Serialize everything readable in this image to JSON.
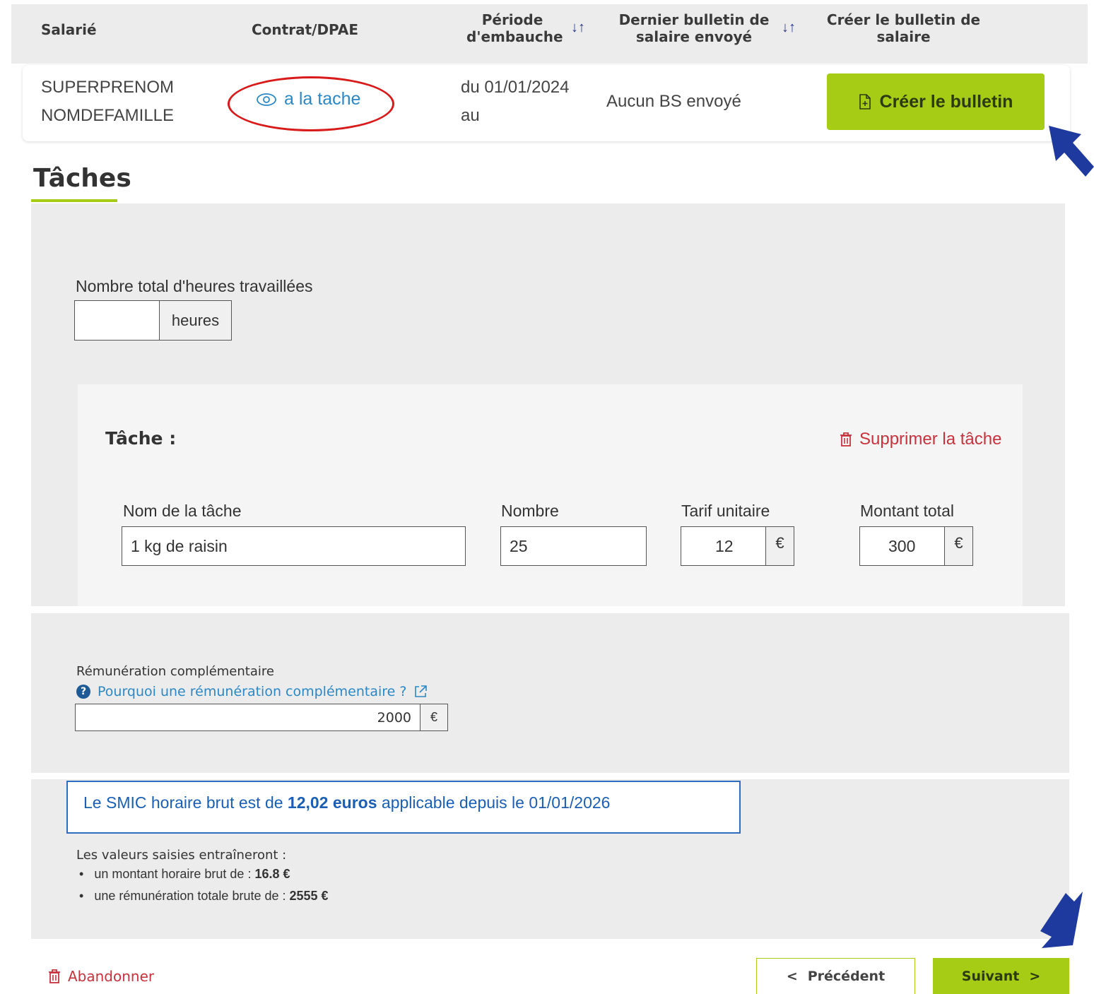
{
  "table": {
    "headers": {
      "salarie": "Salarié",
      "contrat": "Contrat/DPAE",
      "periode_line1": "Période",
      "periode_line2": "d'embauche",
      "dernier_line1": "Dernier bulletin de",
      "dernier_line2": "salaire envoyé",
      "creer_line1": "Créer le bulletin de",
      "creer_line2": "salaire",
      "sort_icon": "↓↑"
    },
    "row": {
      "prenom": "SUPERPRENOM",
      "nom": "NOMDEFAMILLE",
      "contract_link": "a la tache",
      "periode_line1": "du 01/01/2024",
      "periode_line2": "au",
      "dernier": "Aucun BS envoyé",
      "create_button": "Créer le bulletin"
    }
  },
  "section": {
    "title": "Tâches"
  },
  "hours": {
    "label": "Nombre total d'heures travaillées",
    "value": "",
    "unit": "heures"
  },
  "task": {
    "title": "Tâche :",
    "delete_label": "Supprimer la tâche",
    "fields": {
      "name_label": "Nom de la tâche",
      "name_value": "1 kg de raisin",
      "count_label": "Nombre",
      "count_value": "25",
      "unit_price_label": "Tarif unitaire",
      "unit_price_value": "12",
      "total_label": "Montant total",
      "total_value": "300",
      "currency": "€"
    }
  },
  "complement": {
    "label": "Rémunération complémentaire",
    "help_link": "Pourquoi une rémunération complémentaire ?",
    "value": "2000",
    "currency": "€"
  },
  "smic": {
    "prefix": "Le SMIC horaire brut est de ",
    "amount": "12,02 euros",
    "suffix": " applicable depuis le 01/01/2026"
  },
  "summary": {
    "intro": "Les valeurs saisies entraîneront :",
    "item1_label": "un montant horaire brut de : ",
    "item1_value": "16.8 €",
    "item2_label": "une rémunération totale brute de : ",
    "item2_value": "2555 €"
  },
  "footer": {
    "abandon": "Abandonner",
    "prev": "Précédent",
    "next": "Suivant"
  },
  "colors": {
    "accent_green": "#a6cc16",
    "link_blue": "#2c88c4",
    "danger_red": "#c8323c",
    "annotation_red": "#d91a1a",
    "annotation_arrow": "#1f3a9e"
  }
}
